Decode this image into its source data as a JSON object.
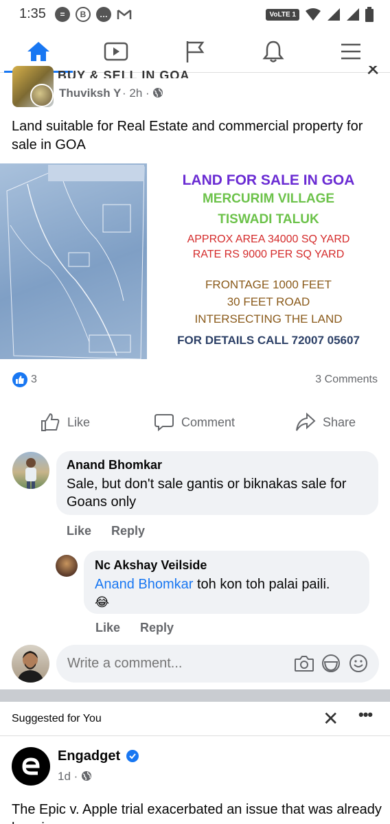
{
  "status_bar": {
    "time": "1:35",
    "volte_label": "VoLTE 1"
  },
  "nav": {
    "items": [
      {
        "name": "home",
        "icon": "home-icon"
      },
      {
        "name": "watch",
        "icon": "video-icon"
      },
      {
        "name": "pages",
        "icon": "flag-icon"
      },
      {
        "name": "notifications",
        "icon": "bell-icon"
      },
      {
        "name": "menu",
        "icon": "hamburger-menu-icon"
      }
    ],
    "active": "home",
    "accent_color": "#1877f2"
  },
  "post": {
    "group_name": "BUY & SELL IN GOA",
    "author": "Thuviksh Y",
    "time": "2h",
    "text": "Land suitable for Real Estate and commercial property for sale in GOA",
    "image": {
      "line1": "LAND FOR SALE IN GOA",
      "line2": "MERCURIM VILLAGE",
      "line3": "TISWADI TALUK",
      "line4": "APPROX AREA 34000 SQ YARD",
      "line5": "RATE RS 9000 PER SQ YARD",
      "line6": "FRONTAGE 1000 FEET",
      "line7": "30 FEET ROAD",
      "line8": "INTERSECTING THE LAND",
      "line9": "FOR DETAILS CALL 72007 05607"
    },
    "like_count": "3",
    "comment_count": "3 Comments",
    "actions": {
      "like": "Like",
      "comment": "Comment",
      "share": "Share"
    }
  },
  "comments": [
    {
      "name": "Anand Bhomkar",
      "text": "Sale, but don't sale gantis or biknakas sale for Goans only",
      "like": "Like",
      "reply": "Reply"
    },
    {
      "name": "Nc Akshay Veilside",
      "mention": "Anand Bhomkar",
      "text": " toh kon toh palai paili.",
      "emoji": "😂",
      "like": "Like",
      "reply": "Reply"
    }
  ],
  "write_comment": {
    "placeholder": "Write a comment..."
  },
  "suggested": {
    "header": "Suggested for You",
    "page_name": "Engadget",
    "time": "1d",
    "text": "The Epic v. Apple trial exacerbated an issue that was already brewing"
  }
}
